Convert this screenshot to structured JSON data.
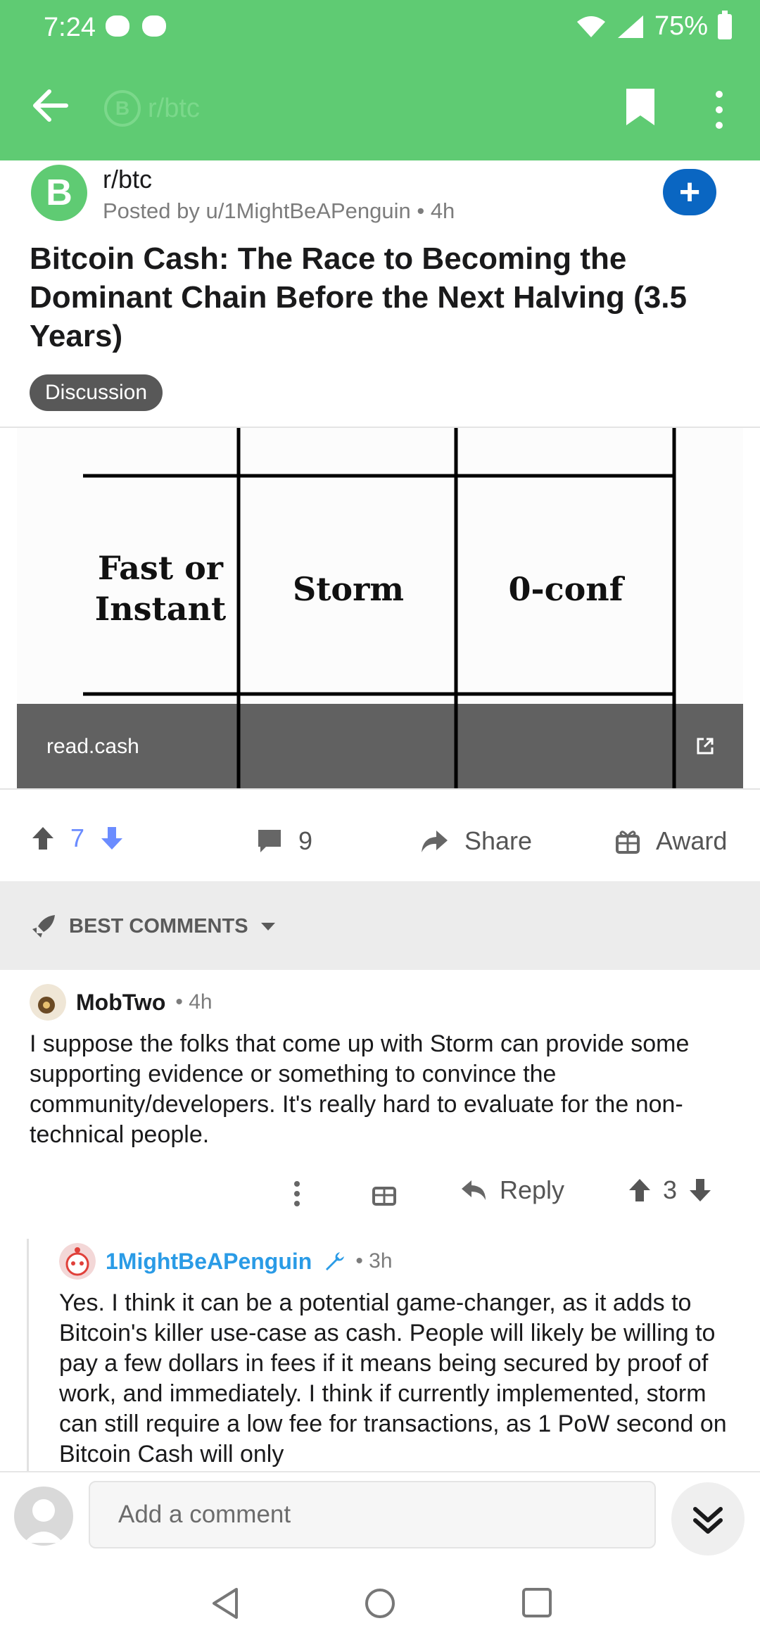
{
  "status_bar": {
    "time": "7:24",
    "battery": "75%"
  },
  "app_bar": {
    "subreddit_title": "r/btc"
  },
  "post": {
    "subreddit": "r/btc",
    "meta": "Posted by u/1MightBeAPenguin • 4h",
    "title": "Bitcoin Cash: The Race to Becoming the Dominant Chain Before the Next Halving (3.5 Years)",
    "flair": "Discussion",
    "preview": {
      "cells": [
        "Fast or\nInstant",
        "Storm",
        "0-conf"
      ],
      "domain": "read.cash"
    },
    "votes": "7",
    "comments_count": "9",
    "share_label": "Share",
    "award_label": "Award"
  },
  "sort": {
    "label": "BEST COMMENTS"
  },
  "comments": [
    {
      "author": "MobTwo",
      "time": "• 4h",
      "body": "I suppose the folks that come up with Storm can provide some supporting evidence or something to convince the community/developers. It's really hard to evaluate for the non-technical people.",
      "reply_label": "Reply",
      "score": "3"
    },
    {
      "author": "1MightBeAPenguin",
      "time": "• 3h",
      "body": "Yes. I think it can be a potential game-changer, as it adds to Bitcoin's killer use-case as cash. People will likely be willing to pay a few dollars in fees if it means being secured by proof of work, and immediately. I think if currently implemented, storm can still require a low fee for transactions, as 1 PoW second on Bitcoin Cash will only"
    }
  ],
  "comment_bar": {
    "placeholder": "Add a comment"
  },
  "colors": {
    "app_green": "#5fcb73",
    "upvote_blue": "#6b8cff",
    "op_blue": "#2a9be6",
    "join_blue": "#0a66c2"
  }
}
